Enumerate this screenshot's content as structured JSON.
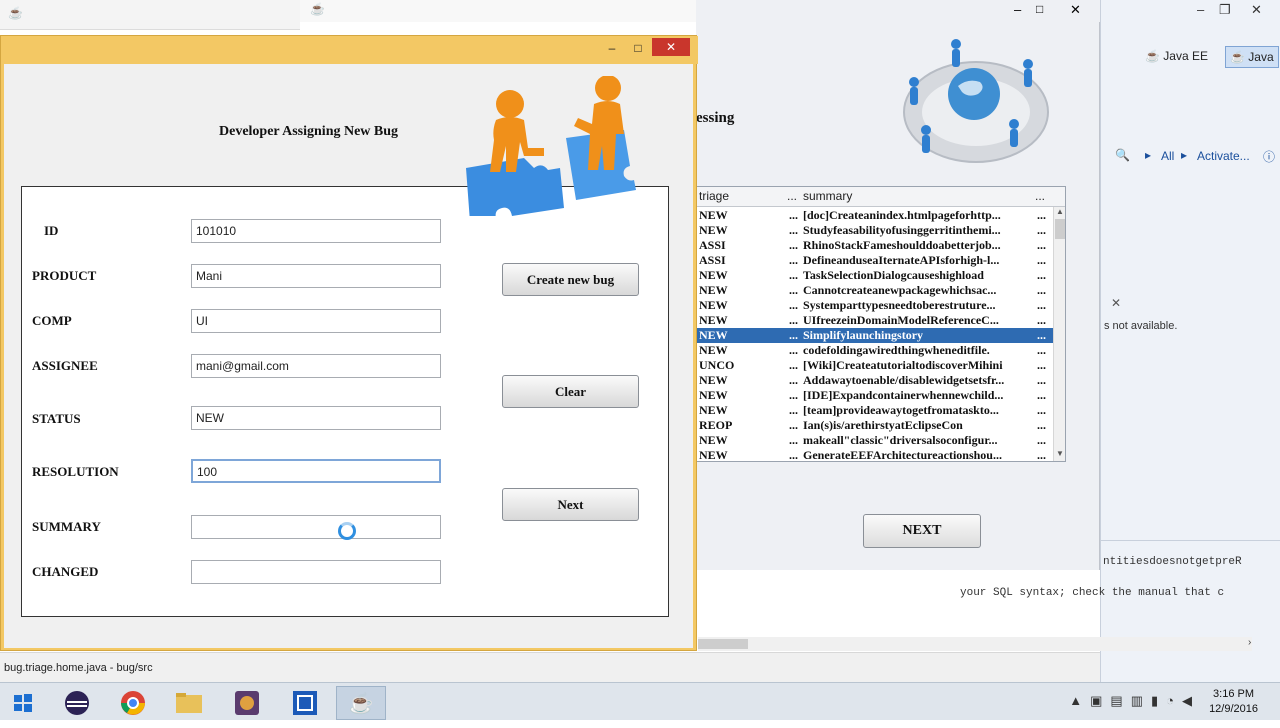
{
  "form": {
    "title": "Developer Assigning New Bug",
    "fields": [
      {
        "label": "ID",
        "value": "101010"
      },
      {
        "label": "PRODUCT",
        "value": "Mani"
      },
      {
        "label": "COMP",
        "value": "UI"
      },
      {
        "label": "ASSIGNEE",
        "value": "mani@gmail.com"
      },
      {
        "label": "STATUS",
        "value": "NEW"
      },
      {
        "label": "RESOLUTION",
        "value": "100"
      },
      {
        "label": "SUMMARY",
        "value": ""
      },
      {
        "label": "CHANGED",
        "value": ""
      }
    ],
    "buttons": {
      "create": "Create new bug",
      "clear": "Clear",
      "next": "Next"
    }
  },
  "triage_window": {
    "heading_fragment": "essing",
    "columns": [
      "triage",
      "...",
      "summary",
      "..."
    ],
    "rows": [
      {
        "triage": "NEW",
        "summary": "[doc]Createanindex.htmlpageforhttp..."
      },
      {
        "triage": "NEW",
        "summary": "Studyfeasabilityofusinggerritinthemi..."
      },
      {
        "triage": "ASSI",
        "summary": "RhinoStackFameshoulddoabetterjob..."
      },
      {
        "triage": "ASSI",
        "summary": "DefineanduseaIternateAPIsforhigh-l..."
      },
      {
        "triage": "NEW",
        "summary": "TaskSelectionDialogcauseshighload"
      },
      {
        "triage": "NEW",
        "summary": "Cannotcreateanewpackagewhichsac..."
      },
      {
        "triage": "NEW",
        "summary": "Systemparttypesneedtoberestruture..."
      },
      {
        "triage": "NEW",
        "summary": "UIfreezeinDomainModelReferenceC..."
      },
      {
        "triage": "NEW",
        "summary": "Simplifylaunchingstory",
        "selected": true
      },
      {
        "triage": "NEW",
        "summary": "codefoldingawiredthingwheneditfile."
      },
      {
        "triage": "UNCO",
        "summary": "[Wiki]CreateatutorialtodiscoverMihini"
      },
      {
        "triage": "NEW",
        "summary": "Addawaytoenable/disablewidgetsetsfr..."
      },
      {
        "triage": "NEW",
        "summary": "[IDE]Expandcontainerwhennewchild..."
      },
      {
        "triage": "NEW",
        "summary": "[team]provideawaytogetfromatasktо..."
      },
      {
        "triage": "REOP",
        "summary": "Ian(s)is/arethirstyatEclipseCon"
      },
      {
        "triage": "NEW",
        "summary": "makeall\"classic\"driversalsoconfigur..."
      },
      {
        "triage": "NEW",
        "summary": "GenerateEEFArchitectureactionshou..."
      }
    ],
    "cell_ellipsis": "...",
    "next_label": "NEXT"
  },
  "eclipse": {
    "perspectives": [
      "Java EE",
      "Java"
    ],
    "all_label": "All",
    "activate_label": "Activate...",
    "not_available": "s not available.",
    "entities_line": "ntitiesdoesnotgetpreR",
    "console_line": "your SQL syntax; check the manual that c"
  },
  "status_bar": {
    "text": "bug.triage.home.java - bug/src"
  },
  "taskbar": {
    "time": "3:16 PM",
    "date": "12/9/2016"
  }
}
